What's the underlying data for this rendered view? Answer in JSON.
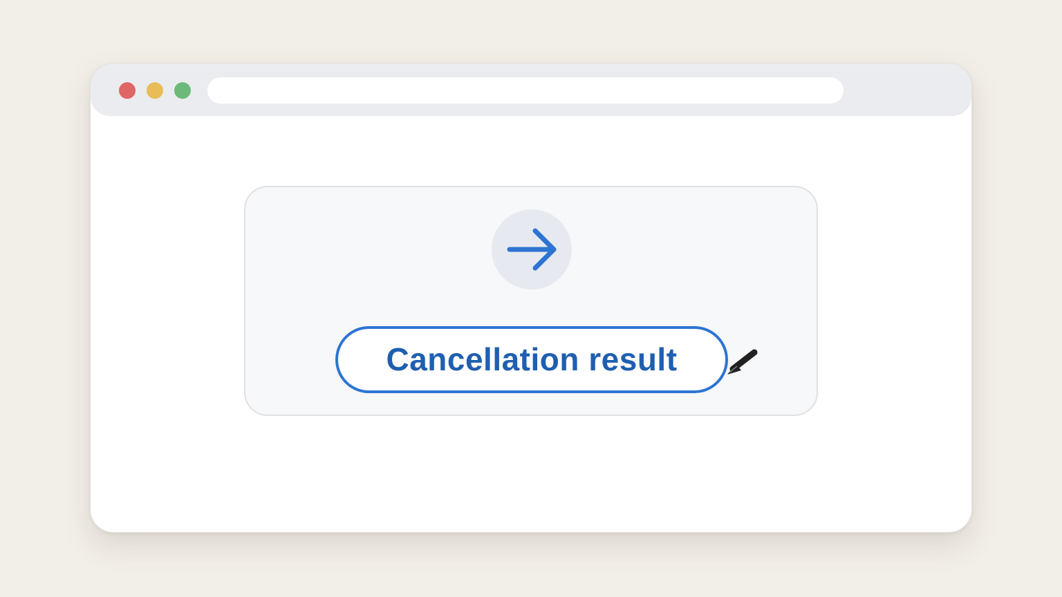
{
  "browser": {
    "controls": {
      "close_color": "#e06666",
      "minimize_color": "#e8bd57",
      "maximize_color": "#6cb97a"
    },
    "address_bar": {
      "value": "",
      "placeholder": ""
    }
  },
  "card": {
    "icon": "arrow-right-icon",
    "button_label": "Cancellation result",
    "accent_color": "#2d74d2"
  },
  "pointer": {
    "icon": "cursor-arrow-icon"
  }
}
